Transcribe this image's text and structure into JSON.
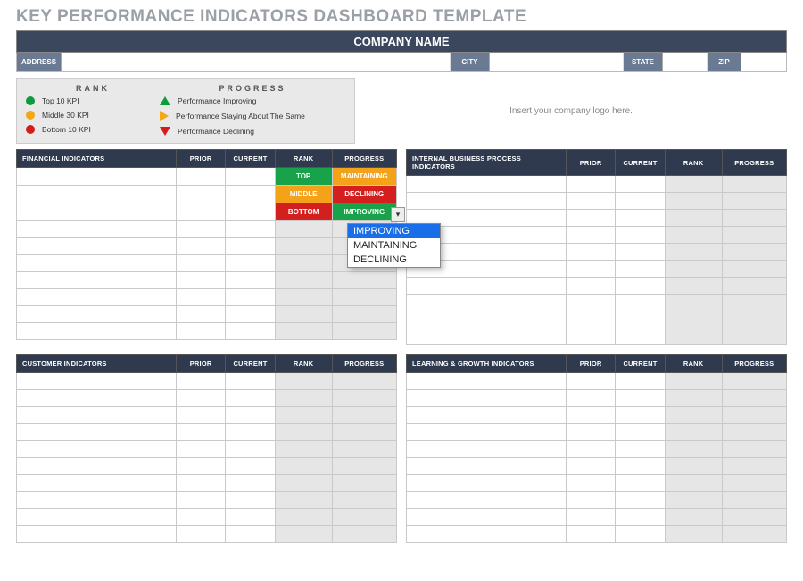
{
  "title": "KEY PERFORMANCE INDICATORS DASHBOARD TEMPLATE",
  "company_bar": "COMPANY NAME",
  "address": {
    "address_label": "ADDRESS",
    "city_label": "CITY",
    "state_label": "STATE",
    "zip_label": "ZIP"
  },
  "legend": {
    "rank_header": "RANK",
    "progress_header": "PROGRESS",
    "rank_items": [
      "Top 10 KPI",
      "Middle 30 KPI",
      "Bottom 10 KPI"
    ],
    "progress_items": [
      "Performance Improving",
      "Performance Staying About The Same",
      "Performance Declining"
    ]
  },
  "logo_placeholder": "Insert your company logo here.",
  "columns": {
    "prior": "PRIOR",
    "current": "CURRENT",
    "rank": "RANK",
    "progress": "PROGRESS"
  },
  "sections": {
    "financial": "FINANCIAL INDICATORS",
    "internal": "INTERNAL BUSINESS PROCESS INDICATORS",
    "customer": "CUSTOMER INDICATORS",
    "learning": "LEARNING & GROWTH INDICATORS"
  },
  "rank_pills": {
    "top": "TOP",
    "middle": "MIDDLE",
    "bottom": "BOTTOM"
  },
  "progress_pills": {
    "maintaining": "MAINTAINING",
    "declining": "DECLINING",
    "improving": "IMPROVING"
  },
  "dropdown": {
    "options": [
      "IMPROVING",
      "MAINTAINING",
      "DECLINING"
    ],
    "selected_index": 0
  }
}
